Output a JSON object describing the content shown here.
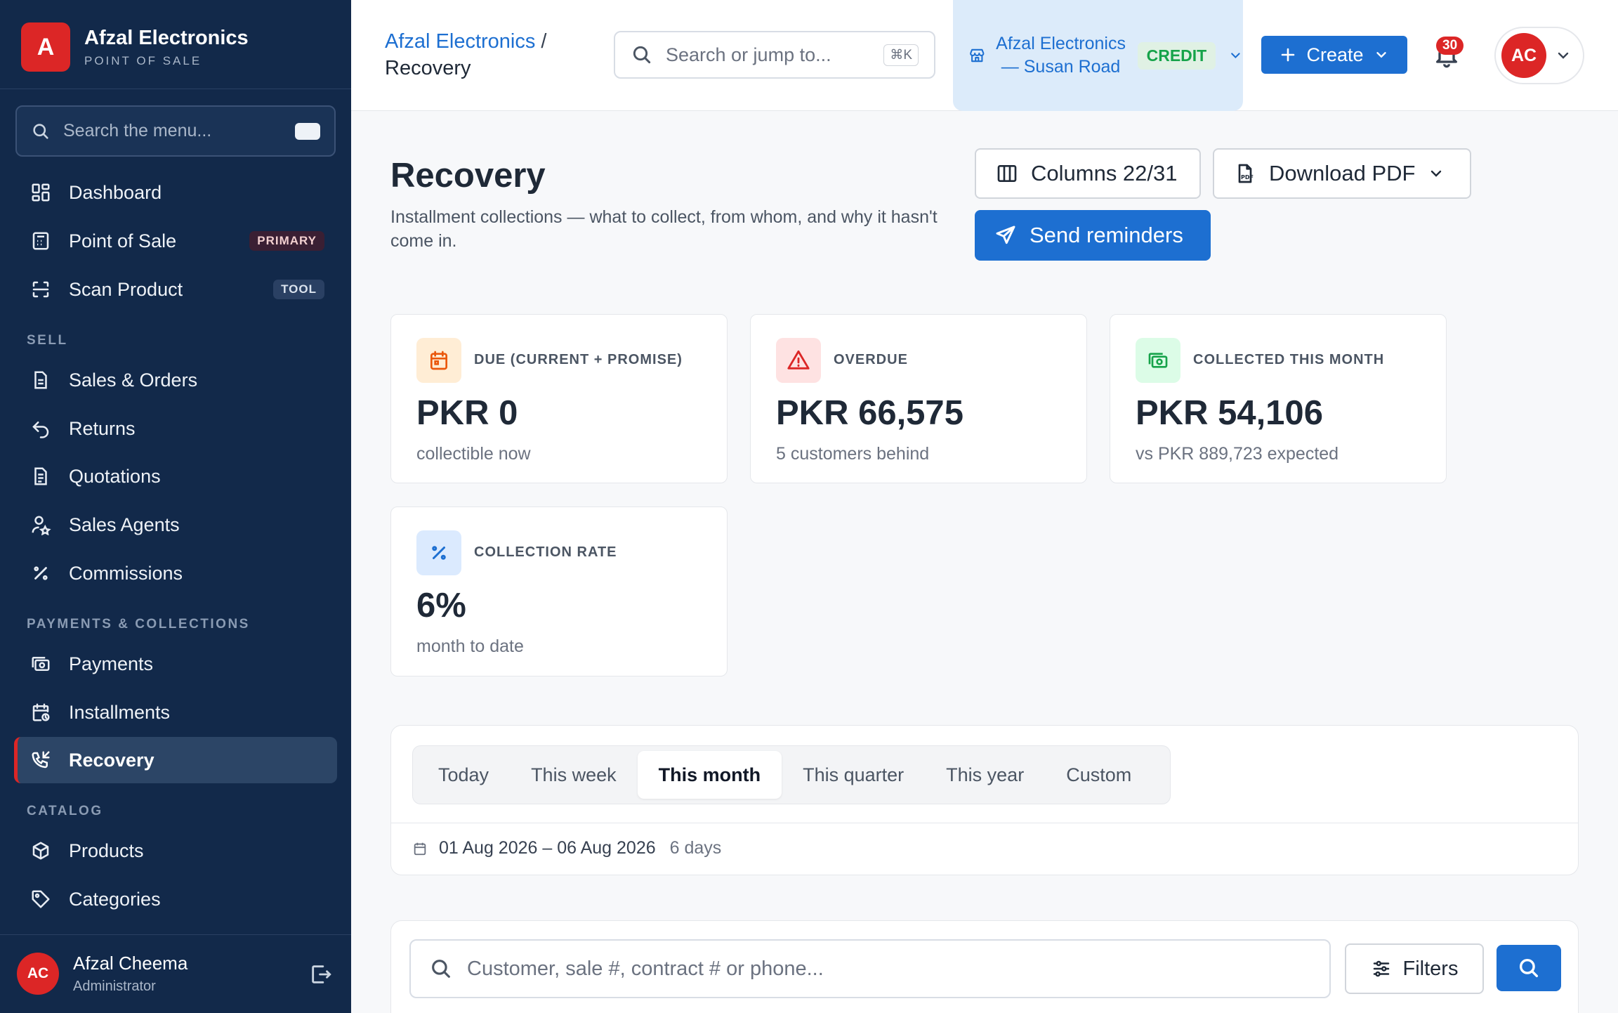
{
  "brand": {
    "initial": "A",
    "name": "Afzal Electronics",
    "subtitle": "POINT OF SALE"
  },
  "sidebar": {
    "search_placeholder": "Search the menu...",
    "items": [
      {
        "label": "Dashboard"
      },
      {
        "label": "Point of Sale",
        "badge": "PRIMARY"
      },
      {
        "label": "Scan Product",
        "badge": "TOOL"
      },
      {
        "label": "Sales & Orders"
      },
      {
        "label": "Returns"
      },
      {
        "label": "Quotations"
      },
      {
        "label": "Sales Agents"
      },
      {
        "label": "Commissions"
      },
      {
        "label": "Payments"
      },
      {
        "label": "Installments"
      },
      {
        "label": "Recovery",
        "active": true
      },
      {
        "label": "Products"
      },
      {
        "label": "Categories"
      }
    ],
    "sections": [
      "SELL",
      "PAYMENTS & COLLECTIONS",
      "CATALOG"
    ],
    "user": {
      "initials": "AC",
      "name": "Afzal Cheema",
      "role": "Administrator"
    }
  },
  "topbar": {
    "breadcrumb": {
      "root": "Afzal Electronics",
      "separator": "/",
      "current": "Recovery"
    },
    "search_placeholder": "Search or jump to...",
    "search_shortcut": "⌘K",
    "store": {
      "name": "Afzal Electronics — Susan Road",
      "tag": "CREDIT"
    },
    "create_label": "Create",
    "notifications_count": "30",
    "avatar_initials": "AC"
  },
  "header": {
    "title": "Recovery",
    "subtitle": "Installment collections — what to collect, from whom, and why it hasn't come in.",
    "columns_label": "Columns 22/31",
    "download_label": "Download PDF",
    "send_label": "Send reminders"
  },
  "cards": [
    {
      "label": "DUE (CURRENT + PROMISE)",
      "value": "PKR 0",
      "note": "collectible now",
      "icon": "calendar-icon",
      "color": "#ea580c",
      "bg": "#ffedd5"
    },
    {
      "label": "OVERDUE",
      "value": "PKR 66,575",
      "note": "5 customers behind",
      "icon": "warning-icon",
      "color": "#dc2626",
      "bg": "#fee2e2"
    },
    {
      "label": "COLLECTED THIS MONTH",
      "value": "PKR 54,106",
      "note": "vs PKR 889,723 expected",
      "icon": "cash-icon",
      "color": "#16a34a",
      "bg": "#dcfce7"
    },
    {
      "label": "COLLECTION RATE",
      "value": "6%",
      "note": "month to date",
      "icon": "percent-icon",
      "color": "#1d6fd1",
      "bg": "#dbeafe"
    }
  ],
  "period": {
    "tabs": [
      "Today",
      "This week",
      "This month",
      "This quarter",
      "This year",
      "Custom"
    ],
    "active_tab": "This month",
    "range": "01 Aug 2026 – 06 Aug 2026",
    "days": "6 days"
  },
  "search": {
    "placeholder": "Customer, sale #, contract # or phone...",
    "filters_label": "Filters"
  },
  "colors": {
    "sidebar": "#12294a",
    "accent": "#1d6fd1",
    "brand_red": "#dc2626"
  }
}
